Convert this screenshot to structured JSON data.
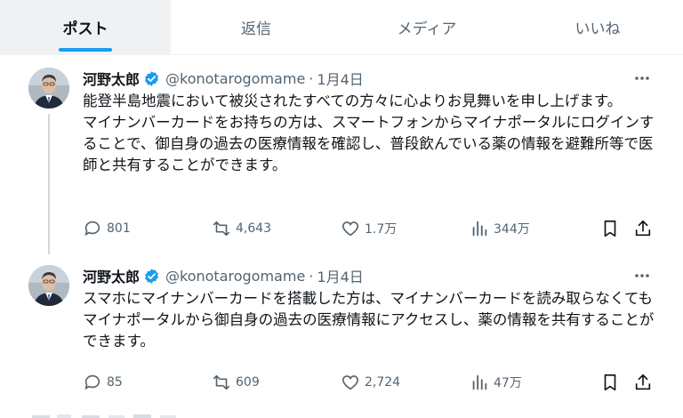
{
  "tabs": [
    {
      "label": "ポスト",
      "active": true
    },
    {
      "label": "返信",
      "active": false
    },
    {
      "label": "メディア",
      "active": false
    },
    {
      "label": "いいね",
      "active": false
    }
  ],
  "tweets": [
    {
      "name": "河野太郎",
      "handle": "@konotarogomame",
      "separator": "·",
      "date": "1月4日",
      "text": [
        "能登半島地震において被災されたすべての方々に心よりお見舞いを申し上げます。",
        "マイナンバーカードをお持ちの方は、スマートフォンからマイナポータルにログインすることで、御自身の過去の医療情報を確認し、普段飲んでいる薬の情報を避難所等で医師と共有することができます。"
      ],
      "replies": "801",
      "reposts": "4,643",
      "likes": "1.7万",
      "views": "344万"
    },
    {
      "name": "河野太郎",
      "handle": "@konotarogomame",
      "separator": "·",
      "date": "1月4日",
      "text": [
        "スマホにマイナンバーカードを搭載した方は、マイナンバーカードを読み取らなくてもマイナポータルから御自身の過去の医療情報にアクセスし、薬の情報を共有することができます。"
      ],
      "replies": "85",
      "reposts": "609",
      "likes": "2,724",
      "views": "47万"
    }
  ],
  "colors": {
    "accent": "#1d9bf0",
    "muted": "#536471",
    "text": "#0f1419"
  },
  "icons": [
    "verified-badge-icon",
    "more-icon",
    "reply-icon",
    "repost-icon",
    "like-icon",
    "views-icon",
    "bookmark-icon",
    "share-icon"
  ]
}
